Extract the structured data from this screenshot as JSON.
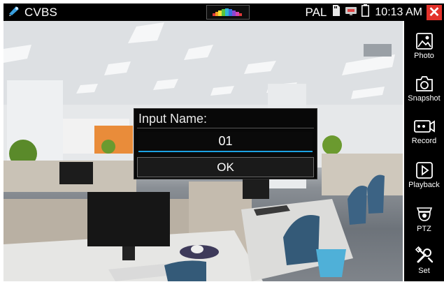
{
  "status_bar": {
    "app_title": "CVBS",
    "app_icon": "camera-icon",
    "video_format": "PAL",
    "sd_icon": "sd-card-icon",
    "network_icon": "network-icon",
    "battery_icon": "battery-icon",
    "time": "10:13 AM",
    "close_icon": "close-icon",
    "close_color": "#e3312a"
  },
  "sidebar": {
    "items": [
      {
        "label": "Photo",
        "icon": "photo-icon"
      },
      {
        "label": "Snapshot",
        "icon": "snapshot-icon"
      },
      {
        "label": "Record",
        "icon": "record-icon"
      },
      {
        "label": "Playback",
        "icon": "playback-icon"
      },
      {
        "label": "PTZ",
        "icon": "ptz-icon"
      },
      {
        "label": "Set",
        "icon": "settings-icon"
      }
    ]
  },
  "dialog": {
    "title": "Input Name:",
    "input_value": "01",
    "ok_label": "OK",
    "accent_color": "#1ba1e2"
  }
}
